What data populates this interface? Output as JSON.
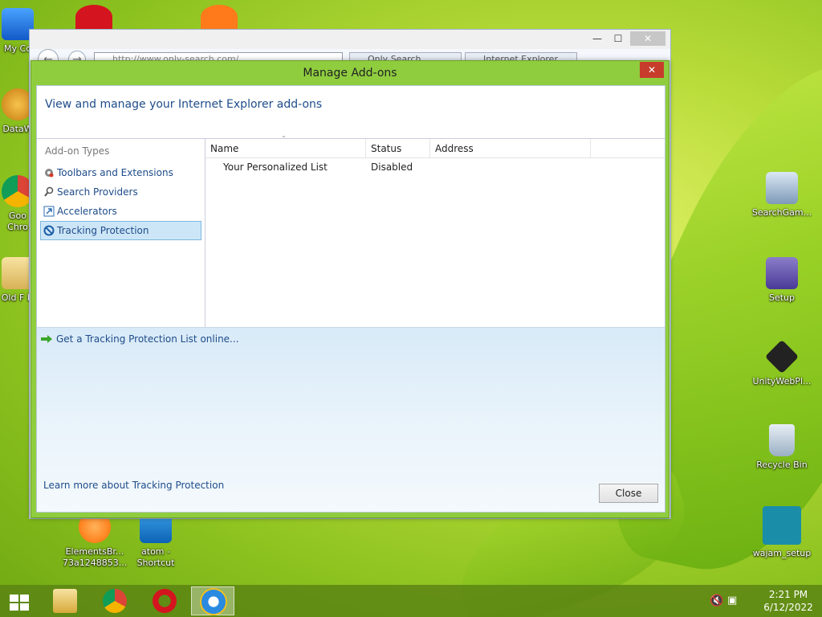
{
  "desktop": {
    "left_icons": [
      {
        "label": "My Co",
        "name": "my-computer"
      },
      {
        "label": "DataW",
        "name": "datawatch"
      },
      {
        "label": "Goo Chro",
        "name": "google-chrome"
      },
      {
        "label": "Old F D",
        "name": "old-files"
      }
    ],
    "right_icons": [
      {
        "label": "SearchGam..."
      },
      {
        "label": "Setup"
      },
      {
        "label": "UnityWebPl..."
      },
      {
        "label": "Recycle Bin"
      },
      {
        "label": "wajam_setup"
      }
    ],
    "bottom_icons": [
      {
        "label": "ElementsBr... 73a1248853..."
      },
      {
        "label": "atom - Shortcut"
      }
    ]
  },
  "ie": {
    "address": "http://www.only-search.com/",
    "tab1": "Only Search",
    "tab2": "Internet Explorer"
  },
  "dialog": {
    "title": "Manage Add-ons",
    "close_x": "✕",
    "header": "View and manage your Internet Explorer add-ons",
    "types_title": "Add-on Types",
    "types": [
      {
        "label": "Toolbars and Extensions"
      },
      {
        "label": "Search Providers"
      },
      {
        "label": "Accelerators"
      },
      {
        "label": "Tracking Protection"
      }
    ],
    "columns": {
      "name": "Name",
      "status": "Status",
      "address": "Address"
    },
    "rows": [
      {
        "name": "Your Personalized List",
        "status": "Disabled",
        "address": ""
      }
    ],
    "get_link": "Get a Tracking Protection List online...",
    "learn_link": "Learn more about Tracking Protection",
    "close_label": "Close"
  },
  "taskbar": {
    "time": "2:21 PM",
    "date": "6/12/2022"
  }
}
